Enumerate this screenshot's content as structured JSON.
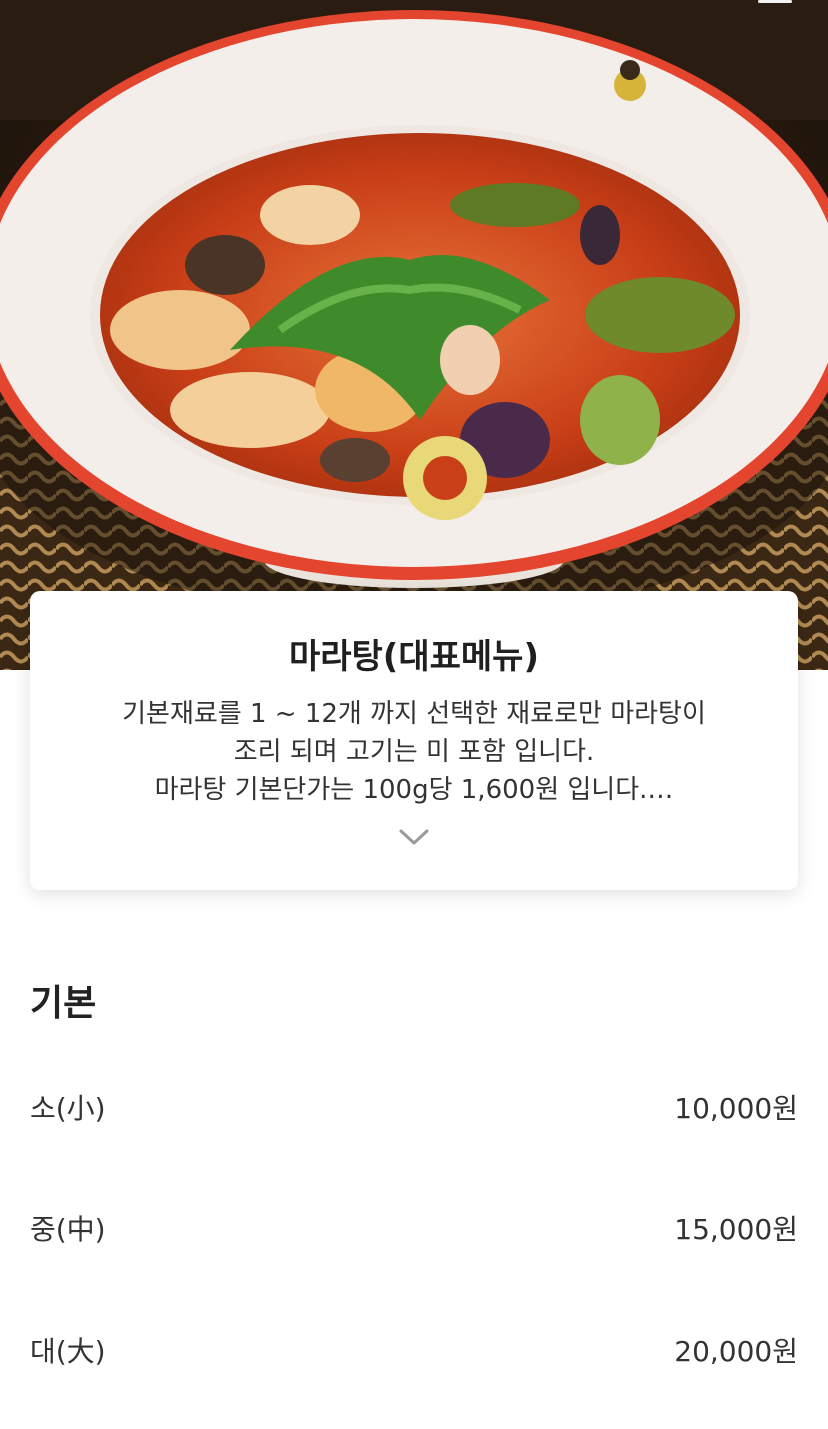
{
  "menu": {
    "title": "마라탕(대표메뉴)",
    "description_lines": [
      "기본재료를 1 ~ 12개 까지 선택한 재료로만 마라탕이",
      "조리 되며 고기는 미 포함 입니다.",
      "마라탕 기본단가는 100g당 1,600원 입니다.…"
    ],
    "expand_icon": "chevron-down-icon",
    "hero_image": "mala-soup-bowl-photo"
  },
  "options_section": {
    "title": "기본",
    "items": [
      {
        "label": "소(小)",
        "price": "10,000원"
      },
      {
        "label": "중(中)",
        "price": "15,000원"
      },
      {
        "label": "대(大)",
        "price": "20,000원"
      }
    ]
  },
  "colors": {
    "broth": "#d24a1c",
    "bowl_rim": "#e0463a",
    "card_bg": "#ffffff"
  }
}
